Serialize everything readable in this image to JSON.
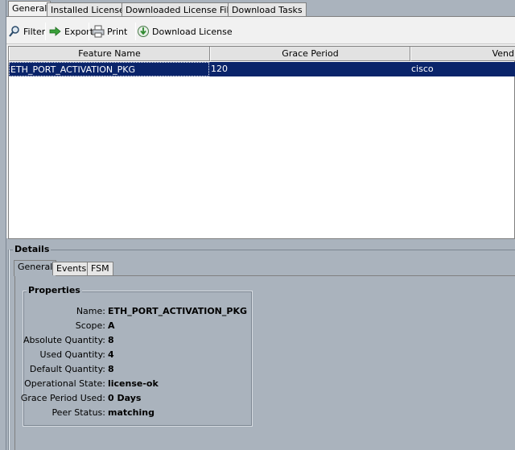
{
  "top_tabs": [
    "General",
    "Installed Licenses",
    "Downloaded License Files",
    "Download Tasks"
  ],
  "toolbar": {
    "filter": "Filter",
    "export": "Export",
    "print": "Print",
    "download_license": "Download License"
  },
  "table": {
    "columns": [
      "Feature Name",
      "Grace Period",
      "Vend"
    ],
    "rows": [
      [
        "ETH_PORT_ACTIVATION_PKG",
        "120",
        "cisco"
      ]
    ]
  },
  "details": {
    "title": "Details",
    "tabs": [
      "General",
      "Events",
      "FSM"
    ],
    "properties_title": "Properties",
    "properties": [
      {
        "label": "Name:",
        "value": "ETH_PORT_ACTIVATION_PKG"
      },
      {
        "label": "Scope:",
        "value": "A"
      },
      {
        "label": "Absolute Quantity:",
        "value": "8"
      },
      {
        "label": "Used Quantity:",
        "value": "4"
      },
      {
        "label": "Default Quantity:",
        "value": "8"
      },
      {
        "label": "Operational State:",
        "value": "license-ok"
      },
      {
        "label": "Grace Period Used:",
        "value": "0 Days"
      },
      {
        "label": "Peer Status:",
        "value": "matching"
      }
    ]
  },
  "colors": {
    "selection": "#0a246a",
    "panel_bg": "#aab3bd"
  }
}
